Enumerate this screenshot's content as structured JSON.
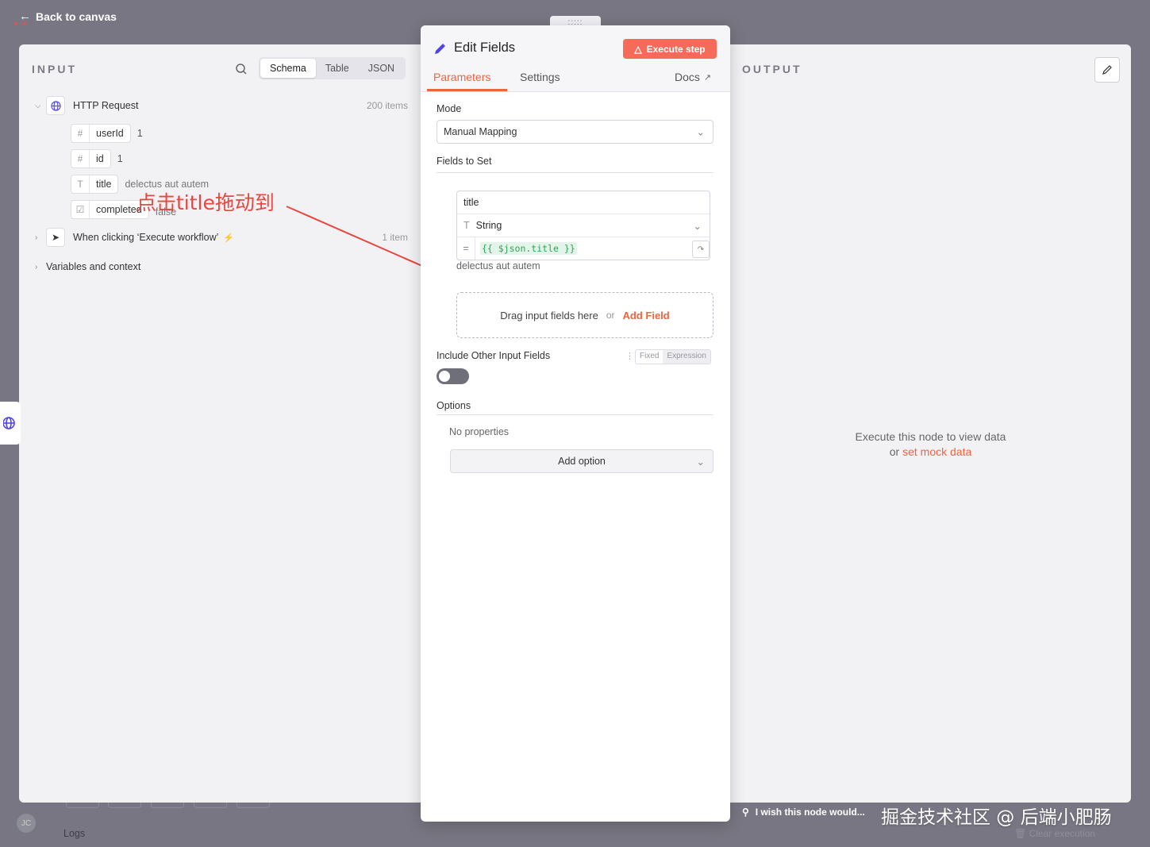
{
  "top": {
    "back_label": "Back to canvas",
    "drag_handle": ":::::"
  },
  "input": {
    "title": "INPUT",
    "view_tabs": [
      "Schema",
      "Table",
      "JSON"
    ],
    "nodes": [
      {
        "name": "HTTP Request",
        "count": "200 items"
      },
      {
        "name": "When clicking ‘Execute workflow’",
        "count": "1 item"
      }
    ],
    "fields": [
      {
        "type_glyph": "#",
        "key": "userId",
        "value": "1"
      },
      {
        "type_glyph": "#",
        "key": "id",
        "value": "1"
      },
      {
        "type_glyph": "T",
        "key": "title",
        "value": "delectus aut autem"
      },
      {
        "type_glyph": "☑",
        "key": "completed",
        "value": "false"
      }
    ],
    "variables_label": "Variables and context"
  },
  "annotation": "点击title拖动到",
  "editor": {
    "title": "Edit Fields",
    "execute_label": "Execute step",
    "tabs": {
      "parameters": "Parameters",
      "settings": "Settings",
      "docs": "Docs"
    },
    "mode_label": "Mode",
    "mode_value": "Manual Mapping",
    "fields_to_set_label": "Fields to Set",
    "field": {
      "name": "title",
      "type": "String",
      "expression": "{{ $json.title }}",
      "preview": "delectus aut autem"
    },
    "dropzone": {
      "text": "Drag input fields here",
      "or": "or",
      "add": "Add Field"
    },
    "include_label": "Include Other Input Fields",
    "fixed_label": "Fixed",
    "expression_label": "Expression",
    "include_enabled": false,
    "options_label": "Options",
    "no_properties": "No properties",
    "add_option_label": "Add option"
  },
  "output": {
    "title": "OUTPUT",
    "empty_line1": "Execute this node to view data",
    "empty_or": "or",
    "empty_link": "set mock data"
  },
  "bottom": {
    "feedback": "I wish this node would...",
    "watermark": "掘金技术社区 @ 后端小肥肠",
    "logs": "Logs",
    "clear_execution": "Clear execution",
    "avatar": "JC"
  },
  "colors": {
    "accent": "#f0633f",
    "execute_bg": "#f66a5a",
    "overlay": "#777682",
    "annotation": "#e8463f"
  }
}
